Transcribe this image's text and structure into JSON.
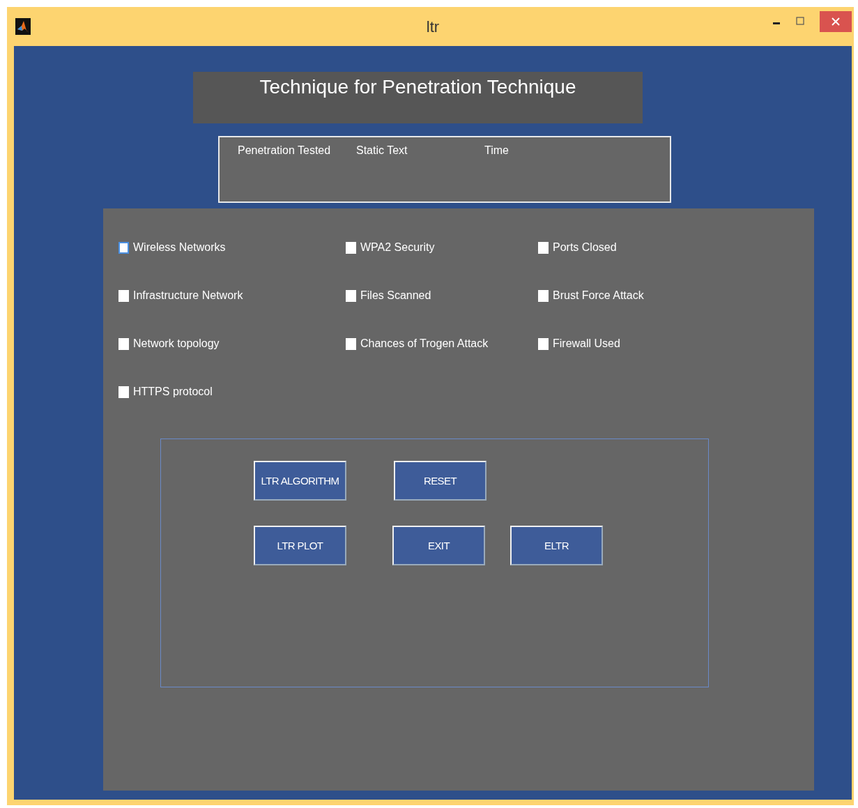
{
  "window": {
    "title": "ltr"
  },
  "heading": "Technique for Penetration Technique",
  "info_labels": [
    "Penetration Tested",
    "Static Text",
    "Time"
  ],
  "checkboxes": [
    {
      "label": "Wireless Networks",
      "checked": false,
      "focused": true
    },
    {
      "label": "WPA2 Security",
      "checked": false,
      "focused": false
    },
    {
      "label": "Ports Closed",
      "checked": false,
      "focused": false
    },
    {
      "label": "Infrastructure Network",
      "checked": false,
      "focused": false
    },
    {
      "label": "Files Scanned",
      "checked": false,
      "focused": false
    },
    {
      "label": "Brust Force Attack",
      "checked": false,
      "focused": false
    },
    {
      "label": "Network topology",
      "checked": false,
      "focused": false
    },
    {
      "label": "Chances of Trogen Attack",
      "checked": false,
      "focused": false
    },
    {
      "label": "Firewall Used",
      "checked": false,
      "focused": false
    },
    {
      "label": "HTTPS protocol",
      "checked": false,
      "focused": false
    }
  ],
  "button_rows": [
    [
      "LTR ALGORITHM",
      "RESET"
    ],
    [
      "LTR PLOT",
      "EXIT",
      "ELTR"
    ]
  ]
}
